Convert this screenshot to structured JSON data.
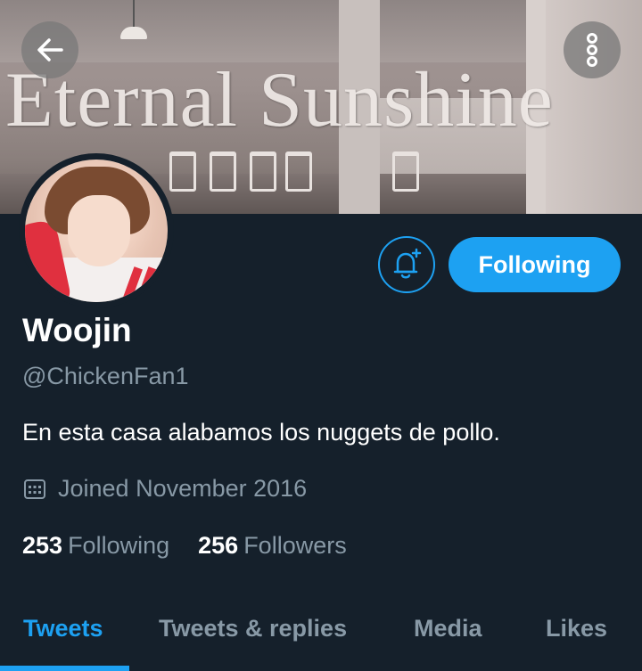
{
  "header": {
    "banner_text": "Eternal Sunshine",
    "back_icon": "arrow-left-icon",
    "more_icon": "vertical-dots-icon"
  },
  "profile": {
    "name": "Woojin",
    "handle": "@ChickenFan1",
    "bio": "En esta casa alabamos los nuggets de pollo.",
    "joined": "Joined November 2016",
    "following_count": "253",
    "following_label": "Following",
    "followers_count": "256",
    "followers_label": "Followers"
  },
  "actions": {
    "notify_icon": "bell-plus-icon",
    "follow_button_label": "Following"
  },
  "tabs": [
    {
      "label": "Tweets",
      "active": true
    },
    {
      "label": "Tweets & replies",
      "active": false
    },
    {
      "label": "Media",
      "active": false
    },
    {
      "label": "Likes",
      "active": false
    }
  ],
  "colors": {
    "background": "#15202b",
    "accent": "#1da1f2",
    "secondary_text": "#8899a6",
    "primary_text": "#ffffff"
  }
}
